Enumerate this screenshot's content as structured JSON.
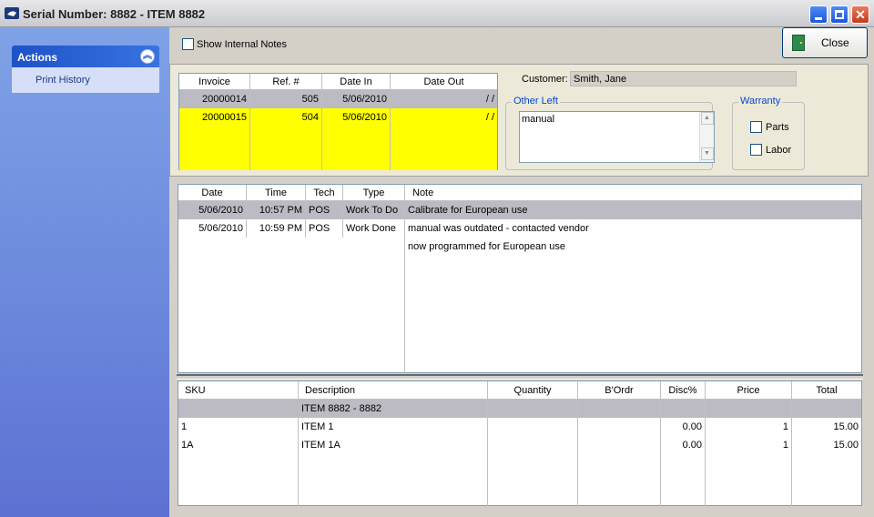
{
  "window": {
    "title": "Serial Number: 8882 - ITEM 8882"
  },
  "sidebar": {
    "panel_title": "Actions",
    "items": [
      {
        "label": "Print History"
      }
    ]
  },
  "toolbar": {
    "show_internal_notes_label": "Show Internal Notes",
    "show_internal_notes_checked": false,
    "close_label": "Close"
  },
  "invoice_table": {
    "columns": [
      "Invoice",
      "Ref. #",
      "Date In",
      "Date Out"
    ],
    "rows": [
      {
        "invoice": "20000014",
        "ref": "505",
        "date_in": "5/06/2010",
        "date_out": "/ /",
        "selected": true
      },
      {
        "invoice": "20000015",
        "ref": "504",
        "date_in": "5/06/2010",
        "date_out": "/ /",
        "highlight": "#ffff00"
      }
    ]
  },
  "customer": {
    "label": "Customer:",
    "value": "Smith, Jane"
  },
  "other_left": {
    "legend": "Other Left",
    "text": "manual"
  },
  "warranty": {
    "legend": "Warranty",
    "parts_label": "Parts",
    "parts_checked": false,
    "labor_label": "Labor",
    "labor_checked": false
  },
  "notes_table": {
    "columns": [
      "Date",
      "Time",
      "Tech",
      "Type",
      "Note"
    ],
    "rows": [
      {
        "date": "5/06/2010",
        "time": "10:57 PM",
        "tech": "POS",
        "type": "Work To Do",
        "note": "Calibrate for European use",
        "selected": true
      },
      {
        "date": "5/06/2010",
        "time": "10:59 PM",
        "tech": "POS",
        "type": "Work Done",
        "note": "manual was outdated - contacted vendor"
      },
      {
        "date": "",
        "time": "",
        "tech": "",
        "type": "",
        "note": "now programmed for European use"
      }
    ]
  },
  "items_table": {
    "columns": [
      "SKU",
      "Description",
      "Quantity",
      "B'Ordr",
      "Disc%",
      "Price",
      "Total"
    ],
    "rows": [
      {
        "sku": "",
        "description": "ITEM 8882 - 8882",
        "quantity": "",
        "bordr": "",
        "disc": "",
        "price": "",
        "total": "",
        "selected": true
      },
      {
        "sku": "1",
        "description": "ITEM 1",
        "quantity": "",
        "bordr": "",
        "disc": "0.00",
        "price": "1",
        "total": "15.00"
      },
      {
        "sku": "1A",
        "description": "ITEM 1A",
        "quantity": "",
        "bordr": "",
        "disc": "0.00",
        "price": "1",
        "total": "15.00"
      }
    ]
  },
  "colors": {
    "highlight_yellow": "#ffff00",
    "selection_gray": "#bcbbc3",
    "sidebar_blue": "#6a86dc",
    "header_blue": "#1e52c8"
  }
}
